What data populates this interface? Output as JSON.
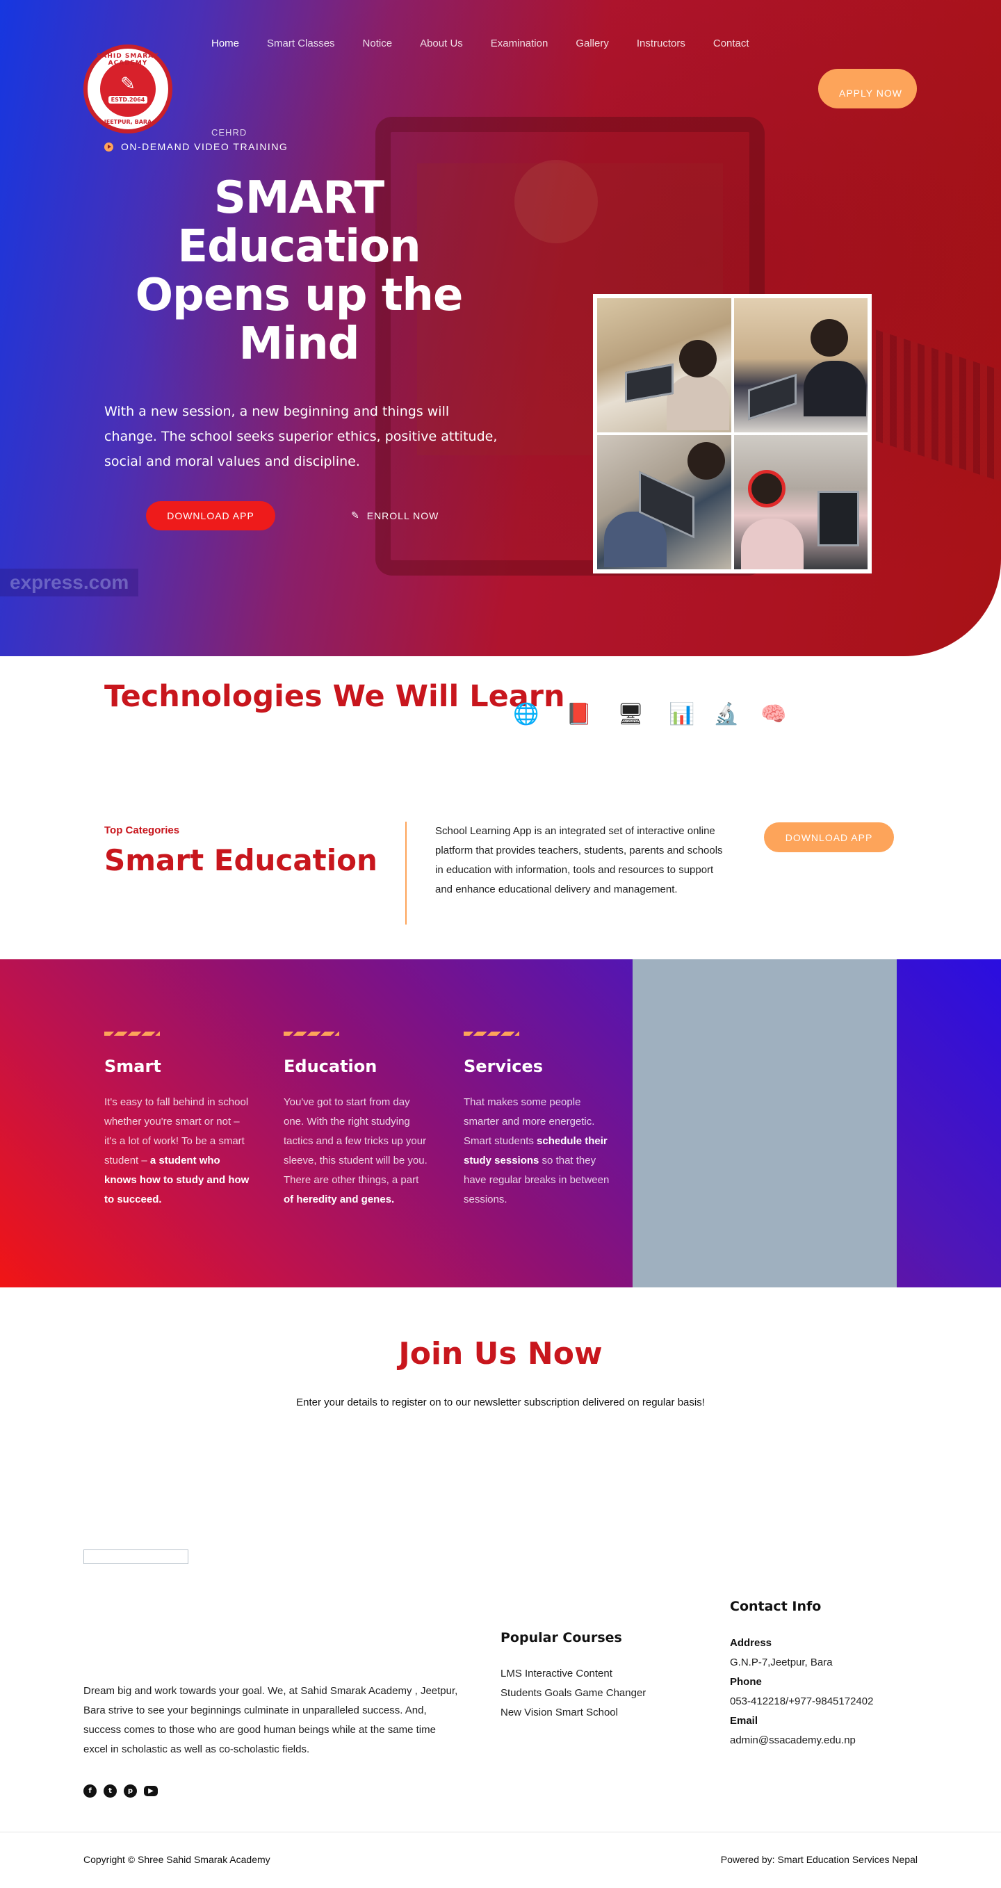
{
  "brand": {
    "logo_top_text": "SAHID SMARAK ACADEMY",
    "logo_bottom_text": "JEETPUR, BARA",
    "logo_estd": "ESTD.2064"
  },
  "nav": {
    "items": [
      "Home",
      "Smart Classes",
      "Notice",
      "About Us",
      "Examination",
      "Gallery",
      "Instructors",
      "Contact"
    ],
    "apply_label": "APPLY NOW"
  },
  "hero": {
    "cehrd": "CEHRD",
    "badge": "ON-DEMAND VIDEO TRAINING",
    "title": "SMART Education Opens up the Mind",
    "description": "With a new session, a new beginning and things will change. The school seeks superior ethics, positive attitude, social and moral values and discipline.",
    "download_label": "DOWNLOAD APP",
    "enroll_label": "ENROLL NOW",
    "watermark": "express.com"
  },
  "technologies": {
    "title": "Technologies We Will Learn",
    "icons": [
      "globe-icon",
      "tablet-icon",
      "monitor-icon",
      "presentation-icon",
      "microscope-icon",
      "brain-icon"
    ]
  },
  "categories": {
    "label": "Top Categories",
    "title": "Smart Education",
    "description": "School Learning App is an integrated set of interactive online platform that provides teachers, students, parents and schools in education with information, tools and resources to support and enhance educational delivery and management.",
    "button": "DOWNLOAD APP"
  },
  "features": [
    {
      "title": "Smart",
      "text_plain": "It's easy to fall behind in school whether you're smart or not – it's a lot of work! To be a smart student – ",
      "text_bold": "a student who knows how to study and how to succeed."
    },
    {
      "title": "Education",
      "text_plain": "You've got to start from day one. With the right studying tactics and a few tricks up your sleeve, this student will be you. There are other things, a part ",
      "text_bold": "of heredity and genes."
    },
    {
      "title": "Services",
      "text_plain": "That makes some people smarter and more energetic. Smart students ",
      "text_bold": "schedule their study sessions",
      "text_after": " so that they have regular breaks in between sessions."
    }
  ],
  "join": {
    "title": "Join Us Now",
    "subtitle": "Enter your details to register on to our newsletter subscription delivered on regular basis!"
  },
  "footer": {
    "about": "Dream big and work towards your goal. We, at Sahid Smarak Academy , Jeetpur, Bara strive to see your beginnings culminate in unparalleled success. And, success comes to those who are good human beings while at the same time excel in scholastic as well as co-scholastic fields.",
    "social": [
      "facebook-icon",
      "twitter-icon",
      "pinterest-icon",
      "youtube-icon"
    ],
    "popular_courses_title": "Popular Courses",
    "courses": [
      "LMS Interactive Content",
      "Students Goals Game Changer",
      "New Vision Smart School"
    ],
    "contact_title": "Contact Info",
    "address_label": "Address",
    "address": "G.N.P-7,Jeetpur, Bara",
    "phone_label": "Phone",
    "phone": "053-412218/+977-9845172402",
    "email_label": "Email",
    "email": "admin@ssacademy.edu.np",
    "copyright": "Copyright © Shree Sahid Smarak Academy",
    "powered": "Powered by: Smart Education Services Nepal"
  },
  "colors": {
    "primary_red": "#c8161d",
    "accent_orange": "#fda45a",
    "hero_blue": "#1637e0",
    "hero_red": "#a81216",
    "band_gray": "#9fb0bf"
  }
}
